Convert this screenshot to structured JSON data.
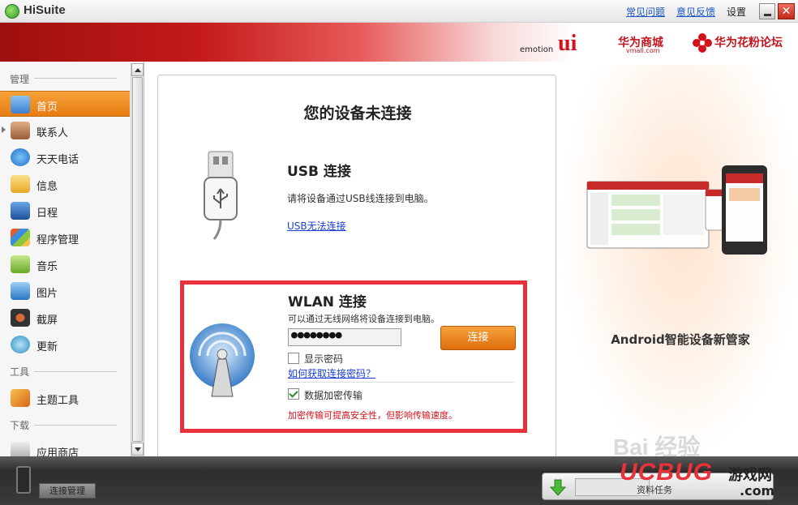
{
  "window": {
    "title": "HiSuite"
  },
  "top_links": {
    "faq": "常见问题",
    "feedback": "意见反馈",
    "settings": "设置",
    "close": "✕"
  },
  "banner": {
    "emotion": "emotion",
    "emotion_ui": "ui",
    "vmall": "华为商城",
    "vmall_sub": "vmall.com",
    "forum": "华为花粉论坛"
  },
  "sidebar": {
    "sections": {
      "manage": "管理",
      "tools": "工具",
      "download": "下载"
    },
    "items": [
      {
        "label": "首页",
        "icon": "home-icon",
        "color": "#4a8fd8"
      },
      {
        "label": "联系人",
        "icon": "contacts-icon",
        "color": "#b9774a"
      },
      {
        "label": "天天电话",
        "icon": "phone-call-icon",
        "color": "#2a8de0"
      },
      {
        "label": "信息",
        "icon": "message-icon",
        "color": "#f3c24a"
      },
      {
        "label": "日程",
        "icon": "calendar-icon",
        "color": "#2d6fb8"
      },
      {
        "label": "程序管理",
        "icon": "app-manager-icon",
        "color": "#6f6f6f"
      },
      {
        "label": "音乐",
        "icon": "music-icon",
        "color": "#8dc63f"
      },
      {
        "label": "图片",
        "icon": "pictures-icon",
        "color": "#3f8ed8"
      },
      {
        "label": "截屏",
        "icon": "screenshot-icon",
        "color": "#444"
      },
      {
        "label": "更新",
        "icon": "update-icon",
        "color": "#3aa0d0"
      },
      {
        "label": "主题工具",
        "icon": "theme-tool-icon",
        "color": "#e68a1a"
      },
      {
        "label": "应用商店",
        "icon": "app-store-icon",
        "color": "#9a9a9a"
      }
    ]
  },
  "main": {
    "title": "您的设备未连接",
    "usb": {
      "title": "USB 连接",
      "description": "请将设备通过USB线连接到电脑。",
      "link": "USB无法连接"
    },
    "wlan": {
      "title": "WLAN 连接",
      "description": "可以通过无线网络将设备连接到电脑。",
      "password_value": "●●●●●●●●",
      "connect_button": "连接",
      "show_password": "显示密码",
      "how_to_link": "如何获取连接密码？",
      "encrypt_label": "数据加密传输",
      "encrypt_checked": true,
      "encrypt_warning": "加密传输可提高安全性，但影响传输速度。"
    }
  },
  "promo": {
    "text": "Android智能设备新管家"
  },
  "bottom": {
    "connection_manager": "连接管理",
    "task_label": "资料任务"
  },
  "watermarks": {
    "ucbug": "UCBUG",
    "games": "游戏网",
    "com": ".com",
    "baidu": "Bai 经验"
  },
  "colors": {
    "accent_orange": "#e67c12",
    "brand_red": "#c51a1a",
    "highlight_red": "#e8313a",
    "link_blue": "#1a3fd6"
  }
}
